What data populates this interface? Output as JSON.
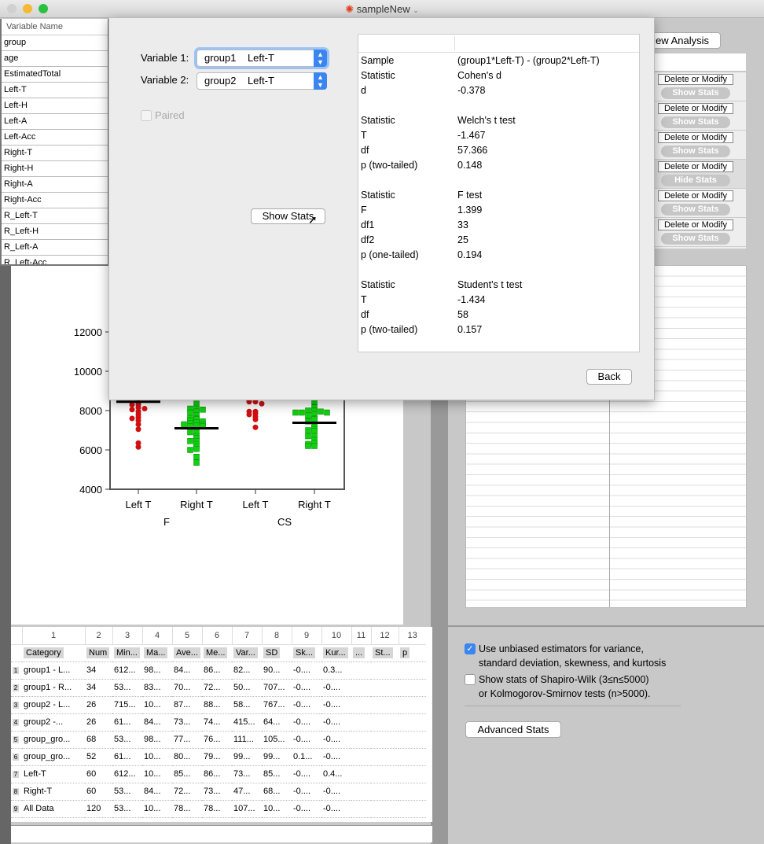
{
  "window": {
    "title": "sampleNew",
    "colors": {
      "close": "#d0d0d0",
      "minimize": "#f5b935",
      "zoom": "#2bc140",
      "accent": "#3a85f0"
    }
  },
  "variables": {
    "header": "Variable Name",
    "items": [
      "group",
      "age",
      "EstimatedTotal",
      "Left-T",
      "Left-H",
      "Left-A",
      "Left-Acc",
      "Right-T",
      "Right-H",
      "Right-A",
      "Right-Acc",
      "R_Left-T",
      "R_Left-H",
      "R_Left-A",
      "R_Left-Acc"
    ]
  },
  "dialog": {
    "var1_label": "Variable 1:",
    "var1_group": "group1",
    "var1_var": "Left-T",
    "var2_label": "Variable 2:",
    "var2_group": "group2",
    "var2_var": "Left-T",
    "paired_label": "Paired",
    "paired_checked": false,
    "show_stats": "Show Stats",
    "back": "Back",
    "results": [
      [
        "Sample",
        "(group1*Left-T) - (group2*Left-T)"
      ],
      [
        "Statistic",
        "Cohen's d"
      ],
      [
        "d",
        "-0.378"
      ],
      [
        "",
        ""
      ],
      [
        "Statistic",
        "Welch's t test"
      ],
      [
        "T",
        "-1.467"
      ],
      [
        "df",
        "57.366"
      ],
      [
        "p (two-tailed)",
        "0.148"
      ],
      [
        "",
        ""
      ],
      [
        "Statistic",
        "F test"
      ],
      [
        "F",
        "1.399"
      ],
      [
        "df1",
        "33"
      ],
      [
        "df2",
        "25"
      ],
      [
        "p (one-tailed)",
        "0.194"
      ],
      [
        "",
        ""
      ],
      [
        "Statistic",
        "Student's t test"
      ],
      [
        "T",
        "-1.434"
      ],
      [
        "df",
        "58"
      ],
      [
        "p (two-tailed)",
        "0.157"
      ]
    ]
  },
  "analysis": {
    "new_label": "New Analysis",
    "delete_label": "Delete or Modify",
    "items": [
      "Show Stats",
      "Show Stats",
      "Show Stats",
      "Hide Stats",
      "Show Stats",
      "Show Stats"
    ]
  },
  "options": {
    "unbiased_label": "Use unbiased estimators for variance,",
    "unbiased_label2": "standard deviation, skewness, and kurtosis",
    "unbiased_checked": true,
    "normality_label": "Show stats of Shapiro-Wilk (3≤n≤5000)",
    "normality_label2": "or Kolmogorov-Smirnov tests (n>5000).",
    "normality_checked": false,
    "advanced": "Advanced Stats"
  },
  "plot": {
    "type": "scatter",
    "ylim": [
      4000,
      12000
    ],
    "yticks": [
      "4000",
      "6000",
      "8000",
      "10000",
      "12000"
    ],
    "categories": [
      "Left T",
      "Right T",
      "Left T",
      "Right T"
    ],
    "groups": [
      "F",
      "CS"
    ],
    "colors": {
      "left": "#d01010",
      "right": "#10d010"
    },
    "series": [
      {
        "values": [
          8400,
          8300,
          8300,
          8150,
          8050,
          8100,
          7950,
          7800,
          7650,
          7600,
          7500,
          7300,
          7050,
          6350,
          6150
        ],
        "mean": 8450
      },
      {
        "values": [
          8350,
          8100,
          8100,
          8050,
          7950,
          7900,
          7750,
          7600,
          7600,
          7550,
          7500,
          7450,
          7400,
          7350,
          7300,
          7300,
          7250,
          7200,
          7200,
          6900,
          6900,
          6700,
          6600,
          6450,
          6450,
          6300,
          6150,
          6050,
          6000,
          5650,
          5350
        ],
        "mean": 7100
      },
      {
        "values": [
          8600,
          8500,
          8450,
          8450,
          8350,
          7950,
          7950,
          7850,
          7800,
          7700,
          7550,
          7150
        ],
        "mean": null
      },
      {
        "values": [
          8450,
          8150,
          8000,
          8000,
          7950,
          7900,
          7900,
          7900,
          7800,
          7750,
          7600,
          7550,
          7450,
          7300,
          7150,
          7050,
          7000,
          6950,
          6700,
          6700,
          6500,
          6350,
          6300,
          6200,
          6200
        ],
        "mean": 7380
      }
    ]
  },
  "stats_table": {
    "col_numbers": [
      "1",
      "2",
      "3",
      "4",
      "5",
      "6",
      "7",
      "8",
      "9",
      "10",
      "11",
      "12",
      "13"
    ],
    "headers": [
      "Category",
      "Num",
      "Min...",
      "Ma...",
      "Ave...",
      "Me...",
      "Var...",
      "SD",
      "Sk...",
      "Kur...",
      "...",
      "St...",
      "p"
    ],
    "rows": [
      [
        "group1 - L...",
        "34",
        "612...",
        "98...",
        "84...",
        "86...",
        "82...",
        "90...",
        "-0....",
        "0.3..."
      ],
      [
        "group1 - R...",
        "34",
        "53...",
        "83...",
        "70...",
        "72...",
        "50...",
        "707...",
        "-0....",
        "-0...."
      ],
      [
        "group2 - L...",
        "26",
        "715...",
        "10...",
        "87...",
        "88...",
        "58...",
        "767...",
        "-0....",
        "-0...."
      ],
      [
        "group2 -...",
        "26",
        "61...",
        "84...",
        "73...",
        "74...",
        "415...",
        "64...",
        "-0....",
        "-0...."
      ],
      [
        "group_gro...",
        "68",
        "53...",
        "98...",
        "77...",
        "76...",
        "111...",
        "105...",
        "-0....",
        "-0...."
      ],
      [
        "group_gro...",
        "52",
        "61...",
        "10...",
        "80...",
        "79...",
        "99...",
        "99...",
        "0.1...",
        "-0...."
      ],
      [
        "Left-T",
        "60",
        "612...",
        "10...",
        "85...",
        "86...",
        "73...",
        "85...",
        "-0....",
        "0.4..."
      ],
      [
        "Right-T",
        "60",
        "53...",
        "84...",
        "72...",
        "73...",
        "47...",
        "68...",
        "-0....",
        "-0...."
      ],
      [
        "All Data",
        "120",
        "53...",
        "10...",
        "78...",
        "78...",
        "107...",
        "10...",
        "-0....",
        "-0...."
      ]
    ]
  }
}
